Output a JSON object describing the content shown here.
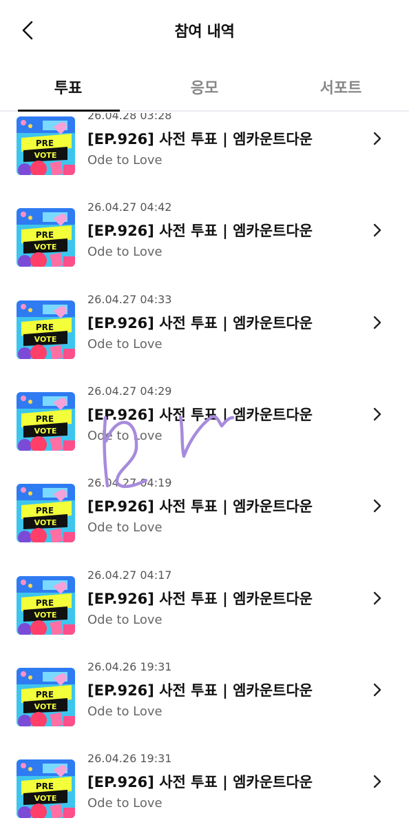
{
  "header": {
    "title": "참여 내역",
    "back_icon": "chevron-left-icon"
  },
  "tabs": [
    {
      "label": "투표",
      "active": true
    },
    {
      "label": "응모",
      "active": false
    },
    {
      "label": "서포트",
      "active": false
    }
  ],
  "colors": {
    "accent": "#111111",
    "tab_inactive": "#888888",
    "divider": "#ececf3",
    "scribble": "#a78bdc"
  },
  "thumbnail": {
    "icon": "pre-vote-thumbnail",
    "line1": "PRE",
    "line2": "VOTE"
  },
  "items": [
    {
      "date": "26.04.28 03:28",
      "title": "[EP.926] 사전 투표 | 엠카운트다운",
      "subtitle": "Ode to Love"
    },
    {
      "date": "26.04.27 04:42",
      "title": "[EP.926] 사전 투표 | 엠카운트다운",
      "subtitle": "Ode to Love"
    },
    {
      "date": "26.04.27 04:33",
      "title": "[EP.926] 사전 투표 | 엠카운트다운",
      "subtitle": "Ode to Love"
    },
    {
      "date": "26.04.27 04:29",
      "title": "[EP.926] 사전 투표 | 엠카운트다운",
      "subtitle": "Ode to Love"
    },
    {
      "date": "26.04.27 04:19",
      "title": "[EP.926] 사전 투표 | 엠카운트다운",
      "subtitle": "Ode to Love"
    },
    {
      "date": "26.04.27 04:17",
      "title": "[EP.926] 사전 투표 | 엠카운트다운",
      "subtitle": "Ode to Love"
    },
    {
      "date": "26.04.26 19:31",
      "title": "[EP.926] 사전 투표 | 엠카운트다운",
      "subtitle": "Ode to Love"
    },
    {
      "date": "26.04.26 19:31",
      "title": "[EP.926] 사전 투표 | 엠카운트다운",
      "subtitle": "Ode to Love"
    }
  ]
}
